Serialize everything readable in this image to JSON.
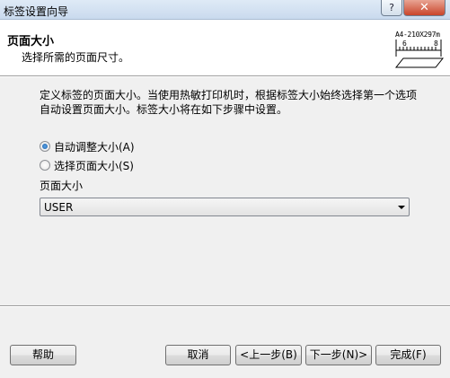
{
  "window": {
    "title": "标签设置向导",
    "help_glyph": "?",
    "close_glyph": "✕"
  },
  "header": {
    "title": "页面大小",
    "subtitle": "选择所需的页面尺寸。",
    "icon_caption": "A4-210X297m",
    "icon_ruler_left": "6",
    "icon_ruler_right": "8"
  },
  "body": {
    "description": "定义标签的页面大小。当使用热敏打印机时，根据标签大小始终选择第一个选项自动设置页面大小。标签大小将在如下步骤中设置。",
    "radio_auto": {
      "label": "自动调整大小(A)",
      "checked": true
    },
    "radio_select": {
      "label": "选择页面大小(S)",
      "checked": false
    },
    "size_label": "页面大小",
    "size_select": {
      "value": "USER"
    }
  },
  "footer": {
    "help": "帮助",
    "cancel": "取消",
    "back": "<上一步(B)",
    "next": "下一步(N)>",
    "finish": "完成(F)"
  }
}
